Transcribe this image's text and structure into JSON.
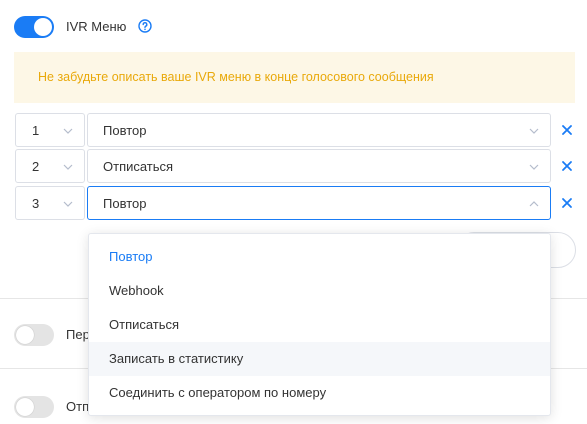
{
  "ivr": {
    "toggle_on": true,
    "label": "IVR Меню"
  },
  "banner": {
    "text": "Не забудьте описать ваше IVR меню в конце голосового сообщения"
  },
  "rows": [
    {
      "number": "1",
      "action": "Повтор"
    },
    {
      "number": "2",
      "action": "Отписаться"
    },
    {
      "number": "3",
      "action": "Повтор"
    }
  ],
  "dropdown": {
    "options": [
      "Повтор",
      "Webhook",
      "Отписаться",
      "Записать в статистику",
      "Соединить с оператором по номеру"
    ],
    "selected": "Повтор",
    "hovered": "Записать в статистику"
  },
  "settings": [
    {
      "label": "Пер",
      "toggle_on": false
    },
    {
      "label": "Отп",
      "toggle_on": false
    }
  ],
  "colors": {
    "accent": "#1a7cf5",
    "warning_text": "#e9a90b",
    "warning_bg": "#fdf7e6"
  }
}
